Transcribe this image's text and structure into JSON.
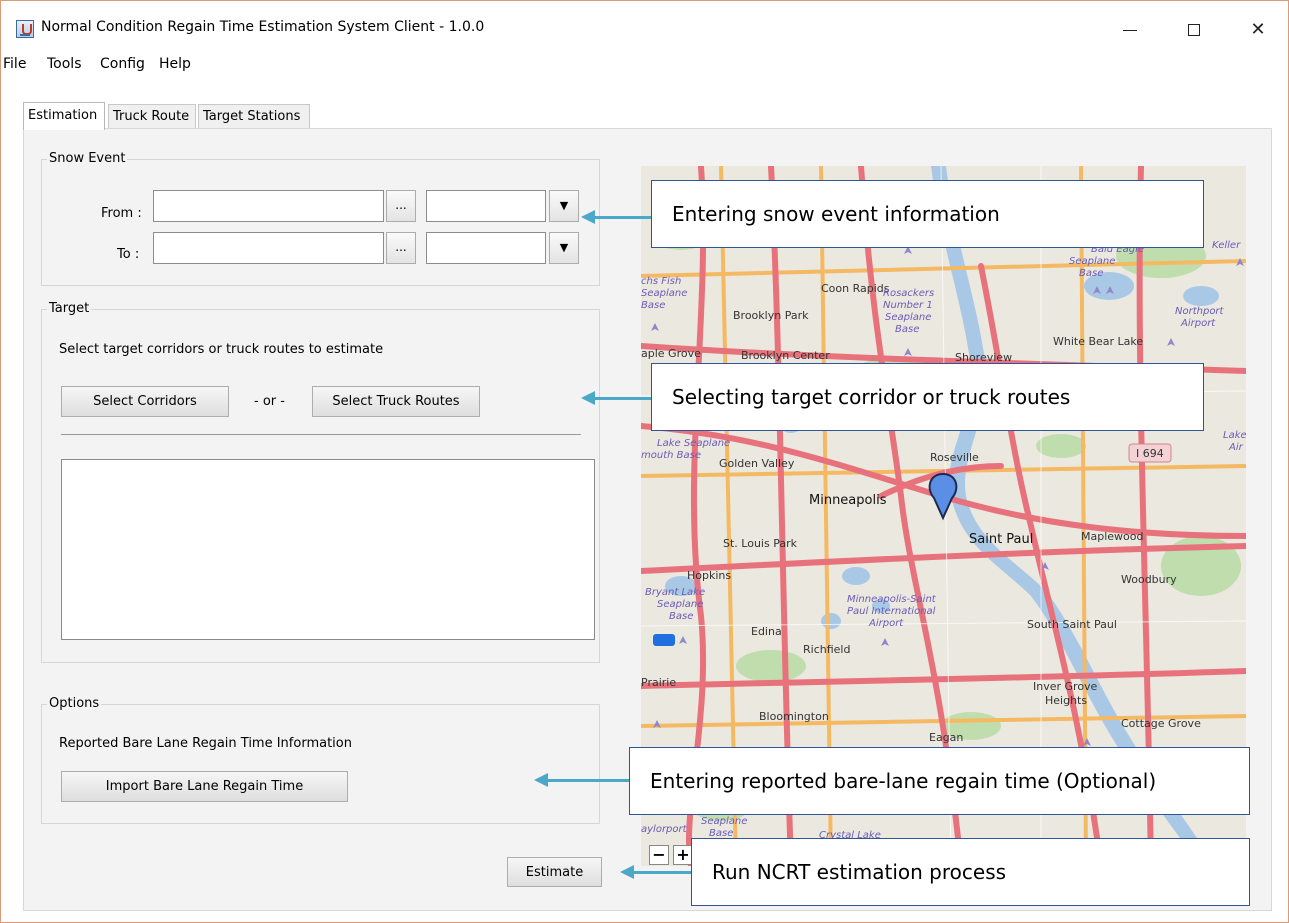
{
  "window": {
    "title": "Normal Condition Regain Time Estimation System Client - 1.0.0",
    "controls": {
      "minimize": "–",
      "maximize": "☐",
      "close": "✕"
    }
  },
  "menu": [
    "File",
    "Tools",
    "Config",
    "Help"
  ],
  "tabs": [
    "Estimation",
    "Truck Route",
    "Target Stations"
  ],
  "snow_event": {
    "group_title": "Snow Event",
    "from_label": "From :",
    "to_label": "To :",
    "from_date": "",
    "from_time": "",
    "to_date": "",
    "to_time": "",
    "picker_label": "...",
    "dropdown_glyph": "▼"
  },
  "target": {
    "group_title": "Target",
    "instruction": "Select target corridors or truck routes to estimate",
    "select_corridors": "Select Corridors",
    "or_text": "- or -",
    "select_truck_routes": "Select Truck Routes",
    "selected_items": []
  },
  "options": {
    "group_title": "Options",
    "bare_lane_label": "Reported Bare Lane Regain Time Information",
    "import_button": "Import Bare Lane Regain Time"
  },
  "estimate_button": "Estimate",
  "map": {
    "labels": {
      "coon_rapids": "Coon Rapids",
      "brooklyn_park": "Brooklyn Park",
      "brooklyn_center": "Brooklyn Center",
      "maple_grove": "aple Grove",
      "shoreview": "Shoreview",
      "white_bear_lake": "White Bear Lake",
      "rosackers": "Rosackers",
      "rosackers2": "Number 1",
      "rosackers3": "Seaplane",
      "rosackers4": "Base",
      "northport": "Northport",
      "northport2": "Airport",
      "bald_eagle": "Bald Eagle",
      "bald_eagle2": "Seaplane",
      "bald_eagle3": "Base",
      "keller": "Keller",
      "fish": "chs Fish",
      "fish2": "Seaplane",
      "fish3": "Base",
      "lake_seaplane": "Lake Seaplane",
      "plymouth": "mouth Base",
      "golden_valley": "Golden Valley",
      "roseville": "Roseville",
      "i694": "I 694",
      "minneapolis": "Minneapolis",
      "saint_paul": "Saint Paul",
      "maplewood": "Maplewood",
      "st_louis_park": "St. Louis Park",
      "hopkins": "Hopkins",
      "bryant": "Bryant Lake",
      "bryant2": "Seaplane",
      "bryant3": "Base",
      "woodbury": "Woodbury",
      "msp": "Minneapolis-Saint",
      "msp2": "Paul International",
      "msp3": "Airport",
      "edina": "Edina",
      "south_saint_paul": "South Saint Paul",
      "richfield": "Richfield",
      "prairie": "Prairie",
      "inver_grove": "Inver Grove",
      "inver_grove2": "Heights",
      "bloomington": "Bloomington",
      "cottage_grove": "Cottage Grove",
      "eagan": "Eagan",
      "lake_air": "Lake",
      "lake_air2": "Air",
      "flyport": "aylorport",
      "seaplane_b": "Seaplane",
      "seaplane_b2": "Base",
      "crystal": "Crystal Lake"
    },
    "zoom_out": "−",
    "zoom_in": "+",
    "colors": {
      "water": "#a9c8e6",
      "highway": "#e8727c",
      "major_road": "#f5b963",
      "park": "#b9dba5",
      "marker": "#5b8fe6"
    }
  },
  "annotations": {
    "snow_event": "Entering snow event information",
    "target": "Selecting target corridor or truck routes",
    "bare_lane": "Entering reported bare-lane regain time (Optional)",
    "run": "Run NCRT estimation process"
  }
}
